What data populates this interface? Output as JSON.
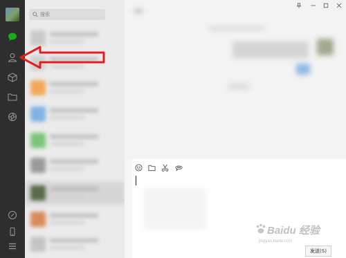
{
  "search": {
    "placeholder": "搜索"
  },
  "sidebar": {
    "items": [
      {
        "name": "chat",
        "icon": "chat-bubble-icon",
        "active": true,
        "color": "#1aad19"
      },
      {
        "name": "contacts",
        "icon": "person-icon"
      },
      {
        "name": "favorites",
        "icon": "cube-icon"
      },
      {
        "name": "files",
        "icon": "folder-icon"
      },
      {
        "name": "moments",
        "icon": "aperture-icon"
      }
    ],
    "bottom": [
      "mini-program-icon",
      "phone-icon",
      "menu-icon"
    ]
  },
  "window_controls": [
    "pin-icon",
    "minimize-icon",
    "maximize-icon",
    "close-icon"
  ],
  "toolbar": [
    "emoji-icon",
    "folder-icon",
    "scissors-icon",
    "chat-history-icon"
  ],
  "send_button": {
    "label": "发送(S)"
  },
  "watermark": {
    "main": "Baidu 经验",
    "sub": "jingyan.baidu.com"
  },
  "annotation": {
    "arrow_color": "#e02020",
    "target": "contacts"
  }
}
